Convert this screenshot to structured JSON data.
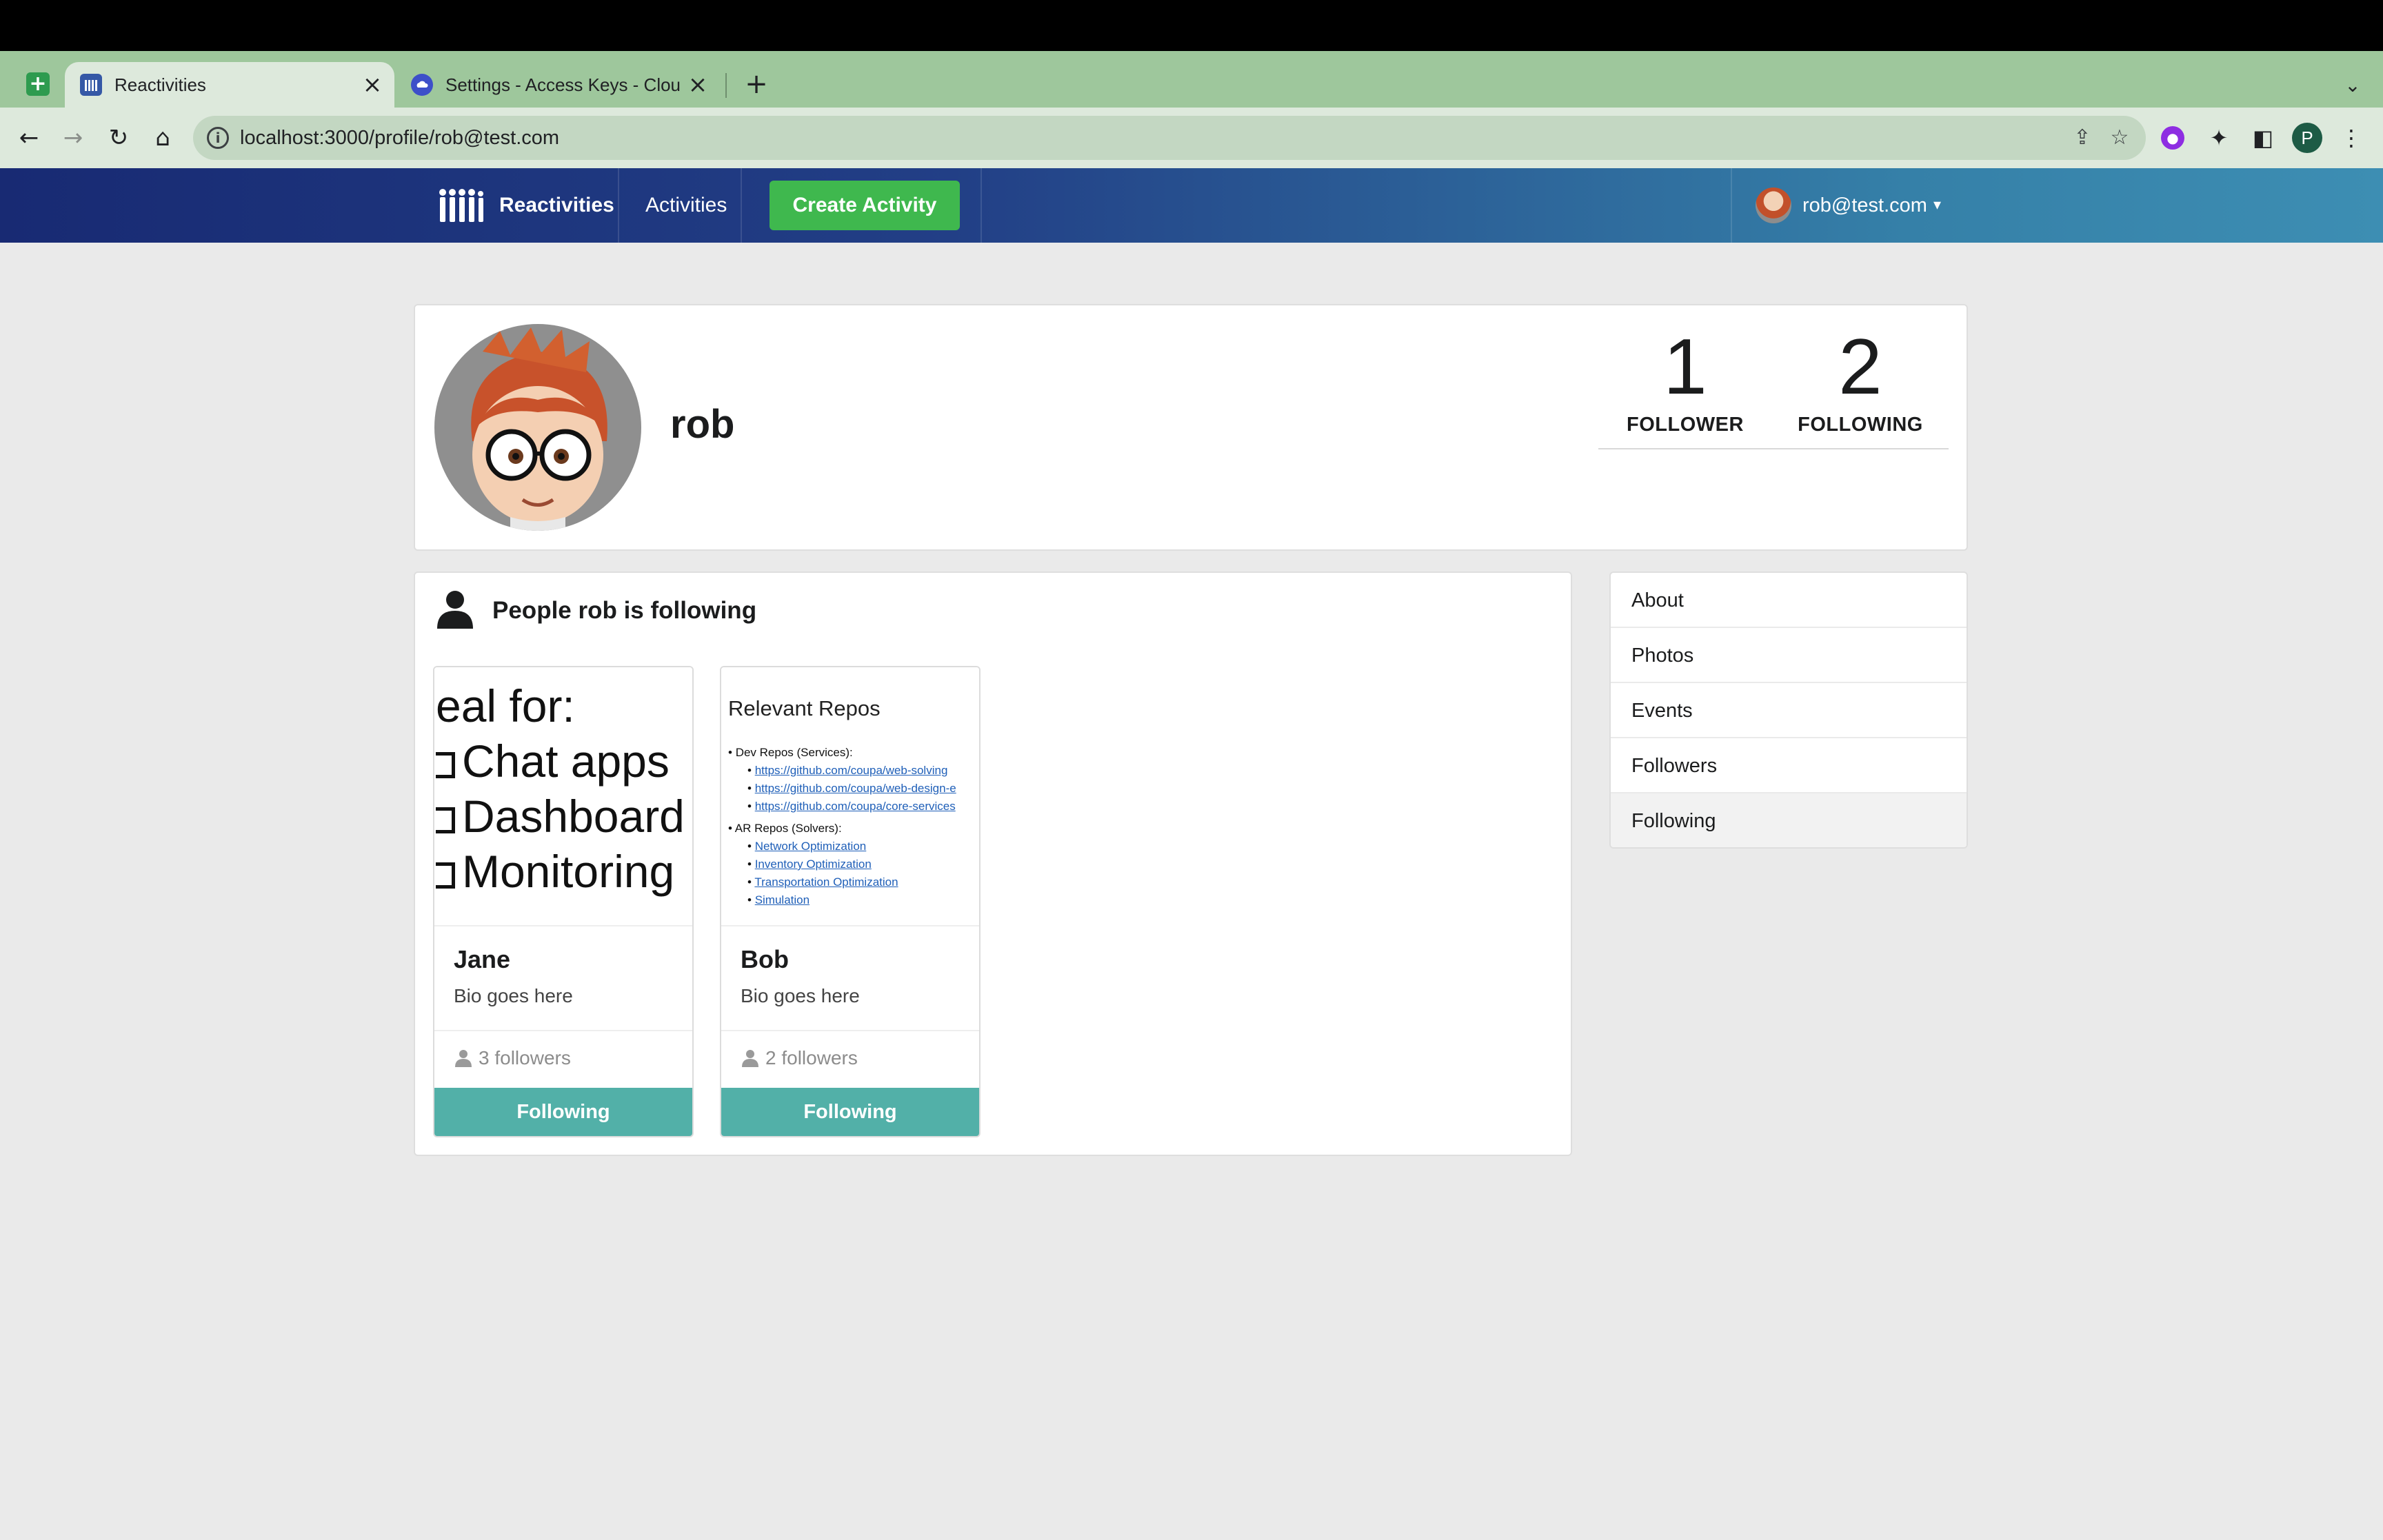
{
  "browser": {
    "tabs": [
      {
        "title": "Reactivities",
        "active": true
      },
      {
        "title": "Settings - Access Keys - Clou",
        "active": false
      }
    ],
    "url": "localhost:3000/profile/rob@test.com",
    "profile_initial": "P"
  },
  "app": {
    "brand": "Reactivities",
    "nav_activities": "Activities",
    "create_activity": "Create Activity",
    "user_email": "rob@test.com"
  },
  "profile": {
    "name": "rob",
    "followers_count": "1",
    "followers_label": "FOLLOWER",
    "following_count": "2",
    "following_label": "FOLLOWING"
  },
  "following_panel": {
    "title": "People rob is following",
    "cards": [
      {
        "name": "Jane",
        "bio": "Bio goes here",
        "followers": "3 followers",
        "button": "Following",
        "thumb_lines": [
          "eal for:",
          "Chat apps",
          "Dashboard",
          "Monitoring"
        ]
      },
      {
        "name": "Bob",
        "bio": "Bio goes here",
        "followers": "2 followers",
        "button": "Following",
        "thumb_title": "Relevant Repos",
        "thumb_dev": "Dev Repos (Services):",
        "thumb_dev_links": [
          "https://github.com/coupa/web-solving",
          "https://github.com/coupa/web-design-e",
          "https://github.com/coupa/core-services"
        ],
        "thumb_ar": "AR Repos (Solvers):",
        "thumb_ar_links": [
          "Network Optimization",
          "Inventory Optimization",
          "Transportation Optimization",
          "Simulation"
        ]
      }
    ]
  },
  "side_menu": {
    "items": [
      "About",
      "Photos",
      "Events",
      "Followers",
      "Following"
    ],
    "active": "Following"
  },
  "colors": {
    "create_button": "#3fb84e",
    "following_button": "#52b0a8"
  }
}
